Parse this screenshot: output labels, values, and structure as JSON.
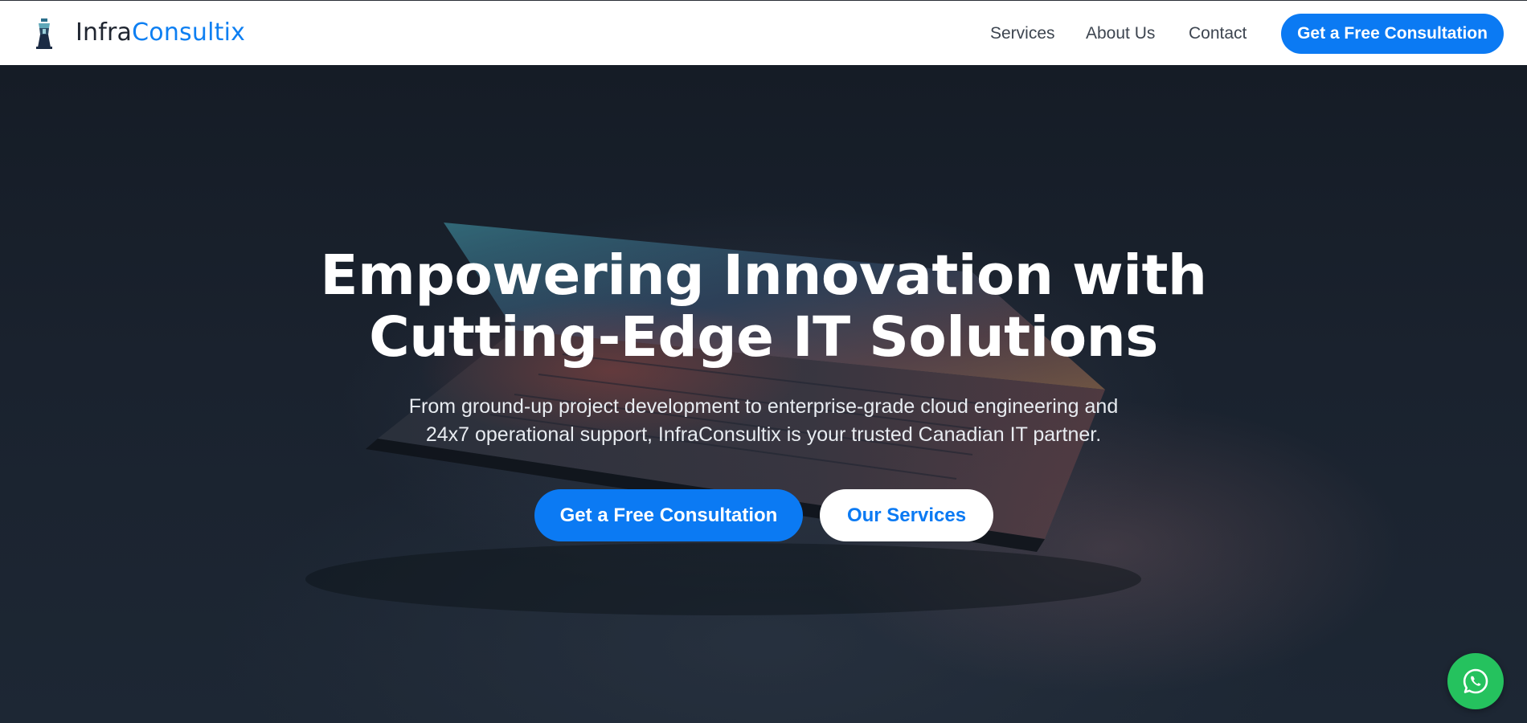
{
  "header": {
    "logo_icon": "lighthouse-icon",
    "brand_part1": "Infra",
    "brand_part2": "Consultix",
    "nav": [
      {
        "label": "Services"
      },
      {
        "label": "About Us"
      },
      {
        "label": "Contact"
      }
    ],
    "cta_label": "Get a Free Consultation"
  },
  "hero": {
    "title_line1": "Empowering Innovation with",
    "title_line2": "Cutting-Edge IT Solutions",
    "subtitle_line1": "From ground-up project development to enterprise-grade cloud engineering and",
    "subtitle_line2": "24x7 operational support, InfraConsultix is your trusted Canadian IT partner.",
    "primary_button": "Get a Free Consultation",
    "secondary_button": "Our Services",
    "background_icon": "laptop-image"
  },
  "floating": {
    "icon": "whatsapp-icon"
  },
  "colors": {
    "accent": "#0b7af3",
    "hero_bg": "#161d26",
    "whatsapp": "#25c25e",
    "header_bg": "#ffffff"
  }
}
